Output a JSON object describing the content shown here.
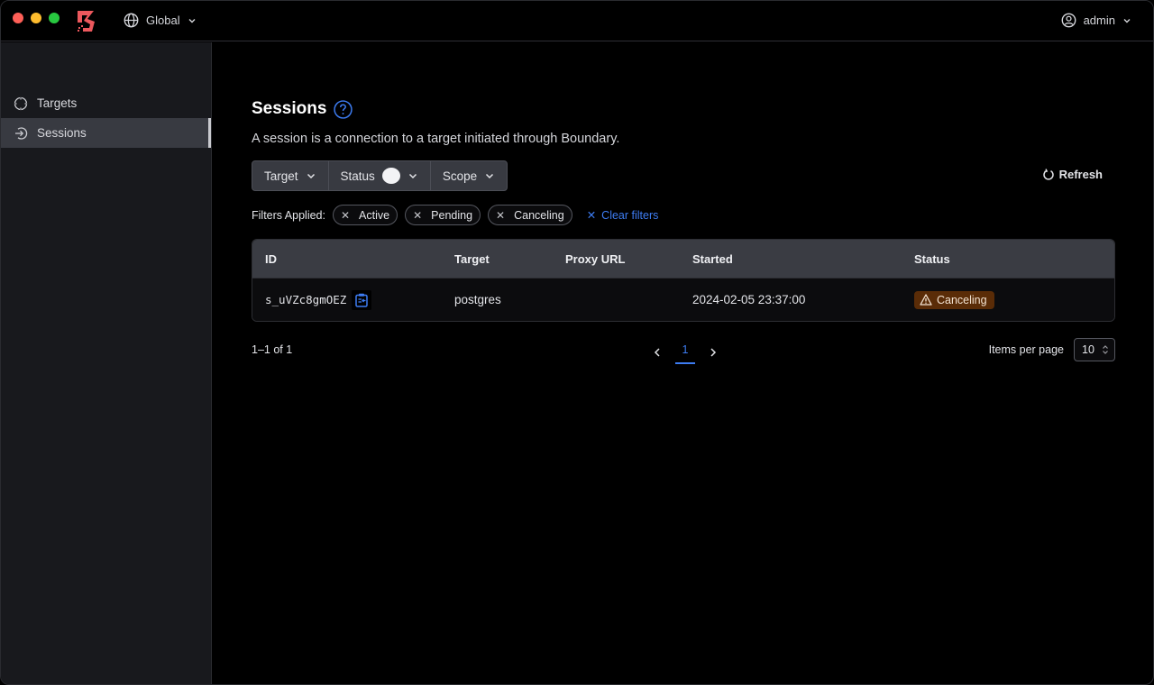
{
  "header": {
    "scope_label": "Global",
    "user_label": "admin",
    "brand_color": "#ec585d"
  },
  "sidebar": {
    "items": [
      {
        "label": "Targets",
        "icon": "crosshair-icon",
        "active": false
      },
      {
        "label": "Sessions",
        "icon": "sign-in-icon",
        "active": true
      }
    ]
  },
  "main": {
    "title": "Sessions",
    "description": "A session is a connection to a target initiated through Boundary.",
    "filters": {
      "buttons": [
        {
          "label": "Target"
        },
        {
          "label": "Status"
        },
        {
          "label": "Scope"
        }
      ],
      "refresh_label": "Refresh",
      "applied_label": "Filters Applied:",
      "applied": [
        "Active",
        "Pending",
        "Canceling"
      ],
      "clear_label": "Clear filters"
    },
    "table": {
      "columns": [
        "ID",
        "Target",
        "Proxy URL",
        "Started",
        "Status"
      ],
      "rows": [
        {
          "id": "s_uVZc8gmOEZ",
          "target": "postgres",
          "proxy_url": "",
          "started": "2024-02-05 23:37:00",
          "status": "Canceling",
          "status_color": "#5a2c07"
        }
      ]
    },
    "pagination": {
      "summary": "1–1 of 1",
      "current_page": "1",
      "items_per_page_label": "Items per page",
      "items_per_page": "10"
    },
    "accent_color": "#3d7cf2"
  }
}
